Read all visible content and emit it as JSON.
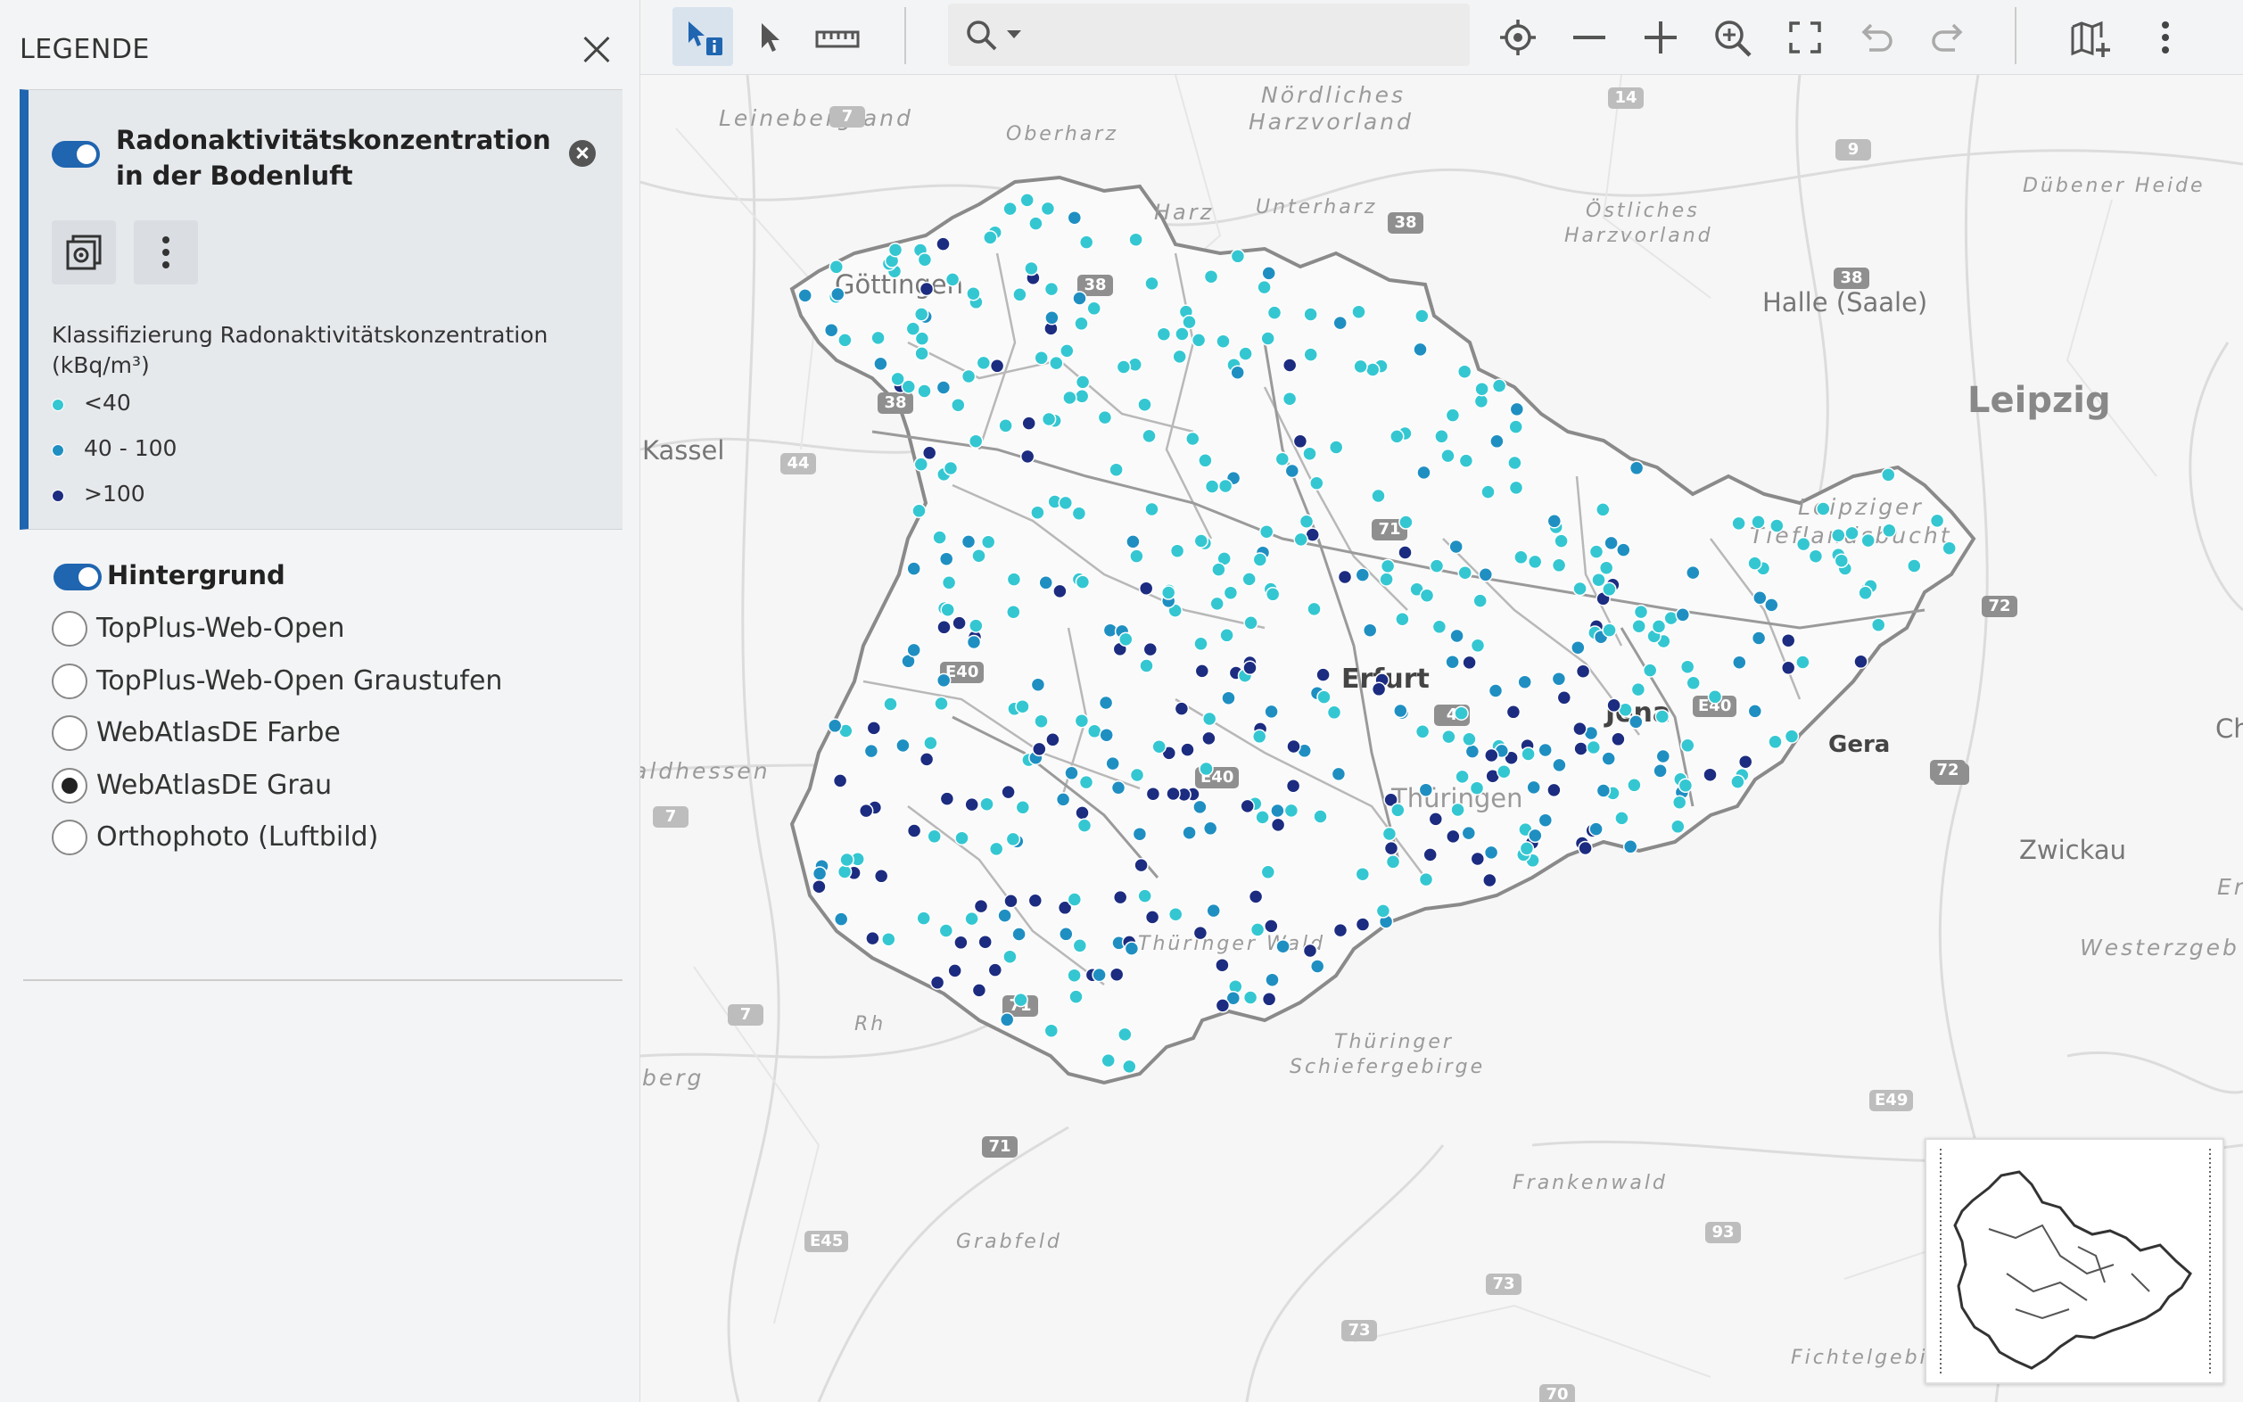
{
  "sidebar": {
    "title": "LEGENDE",
    "close_icon": "close-icon",
    "layer": {
      "name": "Radonaktivitätskonzentration in der Bodenluft",
      "enabled": true,
      "legend_title": "Klassifizierung Radonaktivitätskonzentration (kBq/m³)",
      "classes": [
        {
          "label": "<40",
          "color": "#34c7d2"
        },
        {
          "label": "40 - 100",
          "color": "#1f8fc2"
        },
        {
          "label": ">100",
          "color": "#1c2c80"
        }
      ]
    },
    "background": {
      "title": "Hintergrund",
      "enabled": true,
      "options": [
        {
          "label": "TopPlus-Web-Open",
          "selected": false
        },
        {
          "label": "TopPlus-Web-Open Graustufen",
          "selected": false
        },
        {
          "label": "WebAtlasDE Farbe",
          "selected": false
        },
        {
          "label": "WebAtlasDE Grau",
          "selected": true
        },
        {
          "label": "Orthophoto (Luftbild)",
          "selected": false
        }
      ]
    }
  },
  "toolbar": {
    "search_placeholder": "",
    "accent": "#1f65b0"
  },
  "map": {
    "labels": {
      "leinebergland": "Leinebergland",
      "oberharz": "Oberharz",
      "noerdliches": "Nördliches",
      "harzvorland": "Harzvorland",
      "unterharz": "Unterharz",
      "harz": "Harz",
      "oestliches": "Östliches",
      "harzvorland2": "Harzvorland",
      "duebener": "Dübener Heide",
      "goettingen": "Göttingen",
      "halle": "Halle (Saale)",
      "leipzig": "Leipzig",
      "kassel": "Kassel",
      "leipziger": "Leipziger",
      "tieflandsbucht": "Tieflandsbucht",
      "erfurt": "Erfurt",
      "jena": "Jena",
      "gera": "Gera",
      "thueringen": "Thüringen",
      "waldhessen": "aldhessen",
      "zwickau": "Zwickau",
      "ch": "Ch",
      "thueringerwald": "Thüringer Wald",
      "thueringer2": "Thüringer",
      "schiefergebirge": "Schiefergebirge",
      "westerzge": "Westerzgeb",
      "er": "Er",
      "berg": "berg",
      "frankenwald": "Frankenwald",
      "grabfeld": "Grabfeld",
      "fichtelgebirge": "Fichtelgebirge",
      "rh": "Rh"
    },
    "road_shields": [
      "7",
      "14",
      "9",
      "38",
      "38",
      "38",
      "71",
      "44",
      "E40",
      "E40",
      "4",
      "72",
      "4",
      "E40",
      "72",
      "7",
      "71",
      "7",
      "71",
      "73",
      "93",
      "E45",
      "73",
      "70",
      "E49",
      "38"
    ]
  }
}
